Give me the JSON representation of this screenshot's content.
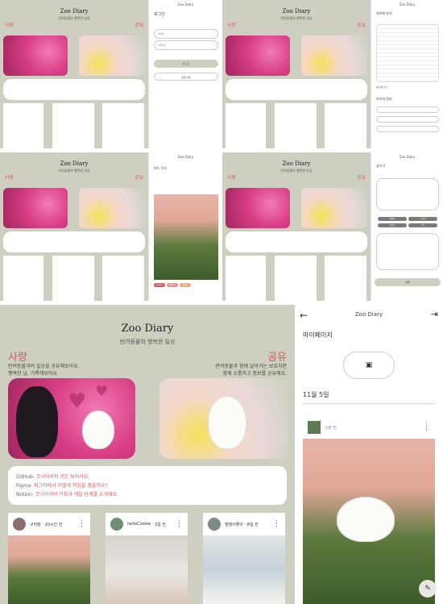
{
  "app": {
    "brand": "Zoo Diary",
    "tagline": "반려동물의 행복한 일상"
  },
  "landing": {
    "love_title": "사랑",
    "love_text": [
      "반려동물과의 일상을 공유해보아요.",
      "행복한 날, 기록해보아요."
    ],
    "share_title": "공유",
    "share_text": [
      "반려동물과 함께 살아가는 보호자분",
      "함께 소통하고 정보를 공유해요."
    ],
    "links": [
      {
        "label": "GitHub:",
        "value": "코너이서의 코드 보러가요."
      },
      {
        "label": "Figma:",
        "value": "피그마에서 어떻게 작업을 했을까요?"
      },
      {
        "label": "Notion:",
        "value": "코너이서의 기획과 개발 단계를 소개해요."
      }
    ],
    "posts": [
      {
        "author": "구미맘",
        "time": "20시간 전"
      },
      {
        "author": "helloCookie",
        "time": "3일 전"
      },
      {
        "author": "댕댕이좋아",
        "time": "8일 전"
      }
    ],
    "menu_icon": "more-vertical-icon"
  },
  "login_panel": {
    "title": "로그인",
    "email_placeholder": "이메일",
    "password_placeholder": "비밀번호",
    "login_button": "로그인",
    "signup_button": "회원가입"
  },
  "terms_panel": {
    "title": "Zoo Diary",
    "terms_label": "약관에 동의",
    "agree_label": "동의합니다",
    "terms_body": "",
    "guardian_label": "보호자 정보"
  },
  "post_panel": {
    "title": "Zoo Diary",
    "heading": "피드 작성",
    "author": "",
    "tags": [
      "#강아지",
      "#말티즈",
      "#일상"
    ]
  },
  "write_panel": {
    "title": "Zoo Diary",
    "heading": "글쓰기",
    "chips": [
      "강아지",
      "고양이",
      "파충류",
      "기타"
    ],
    "submit": "등록"
  },
  "mypage": {
    "title": "Zoo Diary",
    "heading": "마이페이지",
    "date": "11월 5일",
    "post_time": "1분 전",
    "icons": [
      "back-arrow-icon",
      "logout-icon",
      "add-photo-icon",
      "write-fab-icon"
    ]
  }
}
